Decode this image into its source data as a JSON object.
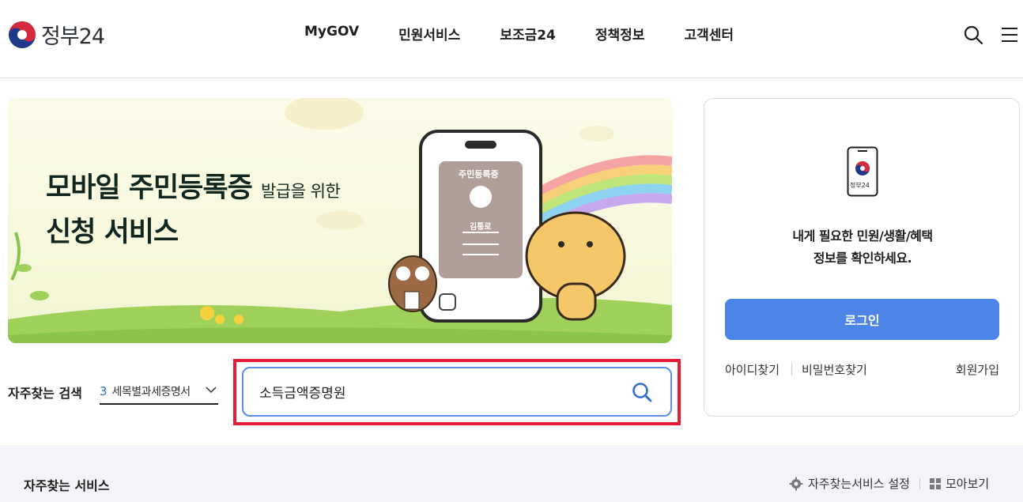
{
  "header": {
    "logo_text": "정부24",
    "nav": [
      "MyGOV",
      "민원서비스",
      "보조금24",
      "정책정보",
      "고객센터"
    ],
    "icons": [
      "search-icon",
      "hamburger-menu-icon"
    ]
  },
  "banner": {
    "title_line1": "모바일 주민등록증",
    "title_line1_small": "발급을 위한",
    "title_line2": "신청 서비스",
    "card_title": "주민등록증",
    "card_name": "김통로"
  },
  "frequent_search": {
    "label": "자주찾는 검색",
    "rank": "3",
    "keyword": "세목별과세증명서"
  },
  "search": {
    "value": "소득금액증명원",
    "icon": "search-icon"
  },
  "login": {
    "logo_text": "정부24",
    "message_line1": "내게 필요한 민원/생활/혜택",
    "message_line2": "정보를 확인하세요.",
    "button": "로그인",
    "find_id": "아이디찾기",
    "find_pw": "비밀번호찾기",
    "signup": "회원가입"
  },
  "services": {
    "title": "자주찾는 서비스",
    "settings": "자주찾는서비스 설정",
    "view_all": "모아보기"
  },
  "colors": {
    "accent_blue": "#4c84e8",
    "highlight_red": "#e11e35",
    "banner_bg": "#f7f8dc"
  }
}
